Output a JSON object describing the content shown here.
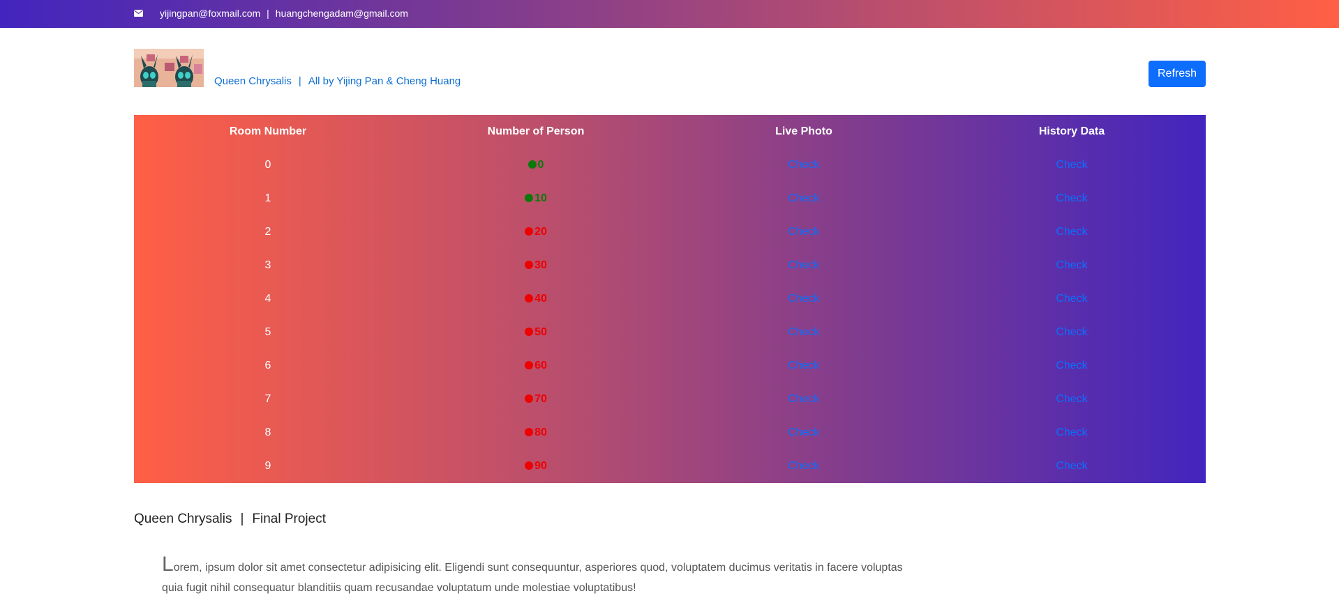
{
  "topbar": {
    "email_1": "yijingpan@foxmail.com",
    "separator": "|",
    "email_2": "huangchengadam@gmail.com",
    "icon": "envelope-icon"
  },
  "brand": {
    "image_alt": "Queen Chrysalis",
    "name": "Queen Chrysalis",
    "separator": "|",
    "credit": "All by Yijing Pan & Cheng Huang"
  },
  "toolbar": {
    "refresh_label": "Refresh"
  },
  "table": {
    "headers": [
      "Room Number",
      "Number of Person",
      "Live Photo",
      "History Data"
    ],
    "rows": [
      {
        "room": "0",
        "count": "0",
        "status": "low",
        "live": "Check",
        "history": "Check"
      },
      {
        "room": "1",
        "count": "10",
        "status": "low",
        "live": "Check",
        "history": "Check"
      },
      {
        "room": "2",
        "count": "20",
        "status": "high",
        "live": "Check",
        "history": "Check"
      },
      {
        "room": "3",
        "count": "30",
        "status": "high",
        "live": "Check",
        "history": "Check"
      },
      {
        "room": "4",
        "count": "40",
        "status": "high",
        "live": "Check",
        "history": "Check"
      },
      {
        "room": "5",
        "count": "50",
        "status": "high",
        "live": "Check",
        "history": "Check"
      },
      {
        "room": "6",
        "count": "60",
        "status": "high",
        "live": "Check",
        "history": "Check"
      },
      {
        "room": "7",
        "count": "70",
        "status": "high",
        "live": "Check",
        "history": "Check"
      },
      {
        "room": "8",
        "count": "80",
        "status": "high",
        "live": "Check",
        "history": "Check"
      },
      {
        "room": "9",
        "count": "90",
        "status": "high",
        "live": "Check",
        "history": "Check"
      }
    ]
  },
  "status_colors": {
    "low": "#0b7a0b",
    "high": "#ee0000"
  },
  "footer": {
    "title_left": "Queen Chrysalis",
    "separator": "|",
    "title_right": "Final Project",
    "paragraph_initial": "L",
    "paragraph_rest": "orem, ipsum dolor sit amet consectetur adipisicing elit. Eligendi sunt consequuntur, asperiores quod, voluptatem ducimus veritatis in facere voluptas quia fugit nihil consequatur blanditiis quam recusandae voluptatum unde molestiae voluptatibus!"
  }
}
